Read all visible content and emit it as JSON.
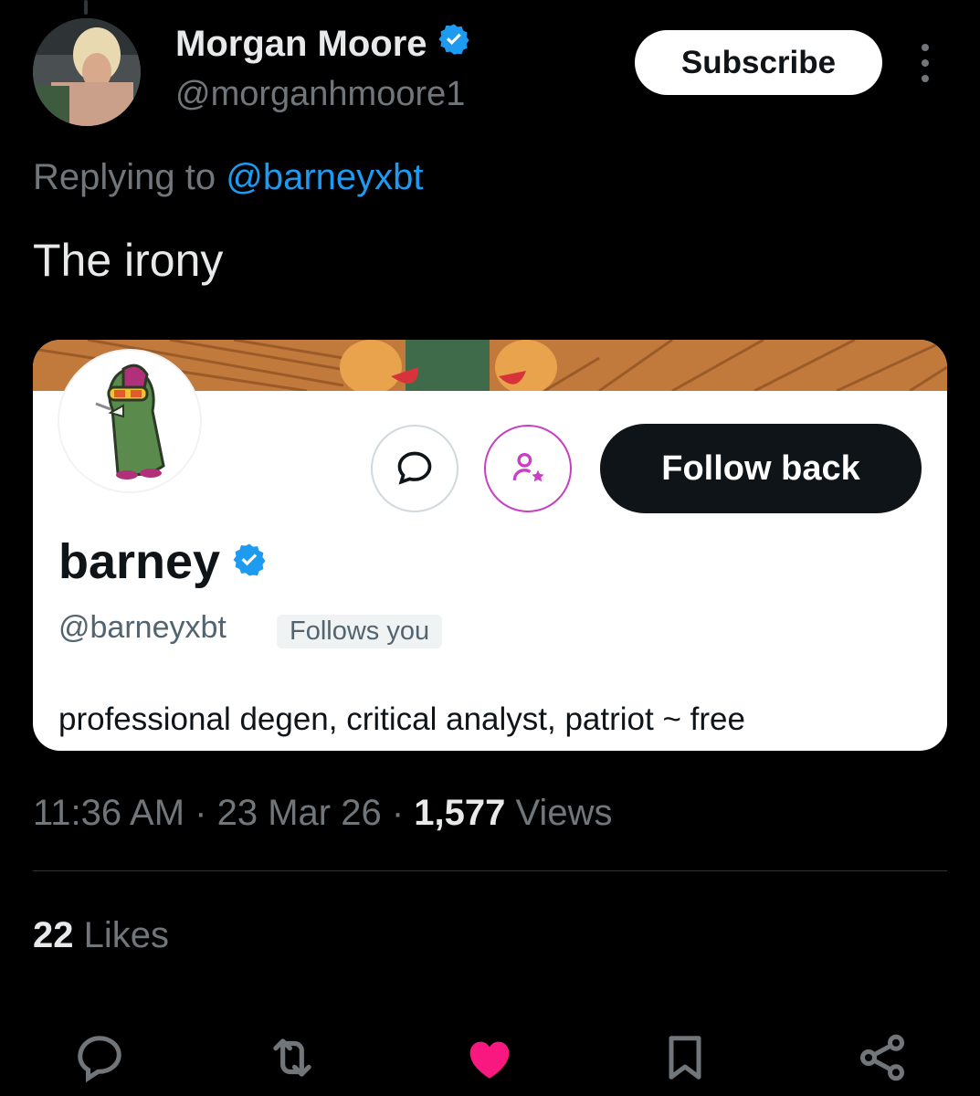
{
  "author": {
    "display_name": "Morgan Moore",
    "handle": "@morganhmoore1",
    "verified": true
  },
  "header": {
    "subscribe_label": "Subscribe"
  },
  "reply": {
    "prefix": "Replying to ",
    "target": "@barneyxbt"
  },
  "tweet": {
    "text": "The irony"
  },
  "embedded_card": {
    "name": "barney",
    "handle": "@barneyxbt",
    "follows_you": "Follows you",
    "follow_back_label": "Follow back",
    "bio": "professional degen, critical analyst, patriot ~ free"
  },
  "meta": {
    "time": "11:36 AM",
    "sep1": " · ",
    "date": "23 Mar 26",
    "sep2": " · ",
    "views_count": "1,577",
    "views_label": " Views"
  },
  "likes": {
    "count": "22",
    "label": " Likes"
  },
  "colors": {
    "background": "#000000",
    "link": "#1d9bf0",
    "like_active": "#f91880",
    "verified": "#1d9bf0",
    "muted": "#71767b"
  },
  "icons": [
    "reply-icon",
    "retweet-icon",
    "like-icon",
    "bookmark-icon",
    "share-icon",
    "more-icon",
    "verified-badge-icon",
    "message-icon",
    "person-star-icon"
  ]
}
